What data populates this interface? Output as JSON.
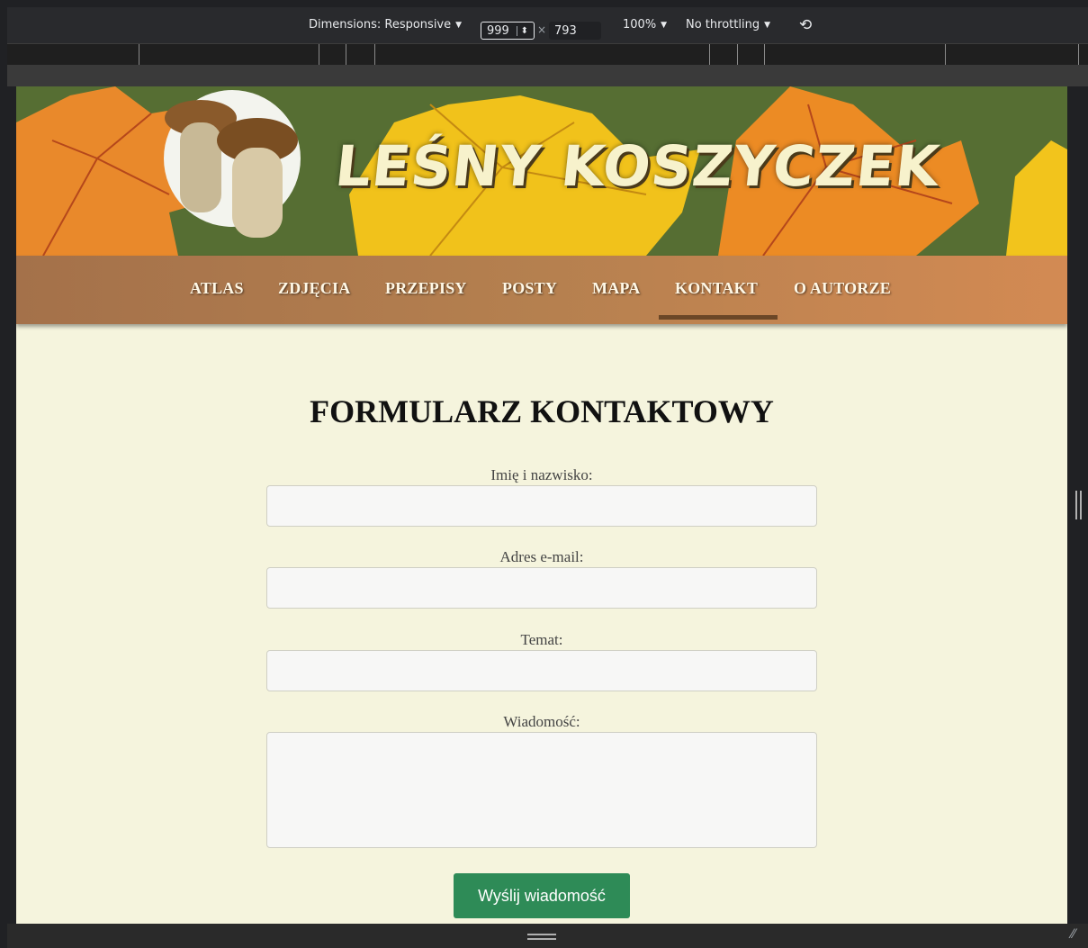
{
  "devtools": {
    "dimensions_label": "Dimensions: Responsive",
    "width_value": "999",
    "height_value": "793",
    "times": "×",
    "zoom": "100%",
    "throttling": "No throttling",
    "dropdown_arrow": "▼",
    "spin_glyph": "⬍",
    "rotate_glyph": "⟲"
  },
  "site": {
    "title": "LEŚNY KOSZYCZEK",
    "nav": [
      {
        "label": "ATLAS"
      },
      {
        "label": "ZDJĘCIA"
      },
      {
        "label": "PRZEPISY"
      },
      {
        "label": "POSTY"
      },
      {
        "label": "MAPA"
      },
      {
        "label": "KONTAKT",
        "active": true
      },
      {
        "label": "O AUTORZE"
      }
    ]
  },
  "form": {
    "title": "FORMULARZ KONTAKTOWY",
    "fields": [
      {
        "label": "Imię i nazwisko:",
        "value": ""
      },
      {
        "label": "Adres e-mail:",
        "value": ""
      },
      {
        "label": "Temat:",
        "value": ""
      },
      {
        "label": "Wiadomość:",
        "value": ""
      }
    ],
    "submit_label": "Wyślij wiadomość"
  },
  "colors": {
    "banner_green": "#566e33",
    "nav_brown": "#b5804f",
    "page_bg": "#f5f4dd",
    "button_green": "#2e8b57"
  }
}
